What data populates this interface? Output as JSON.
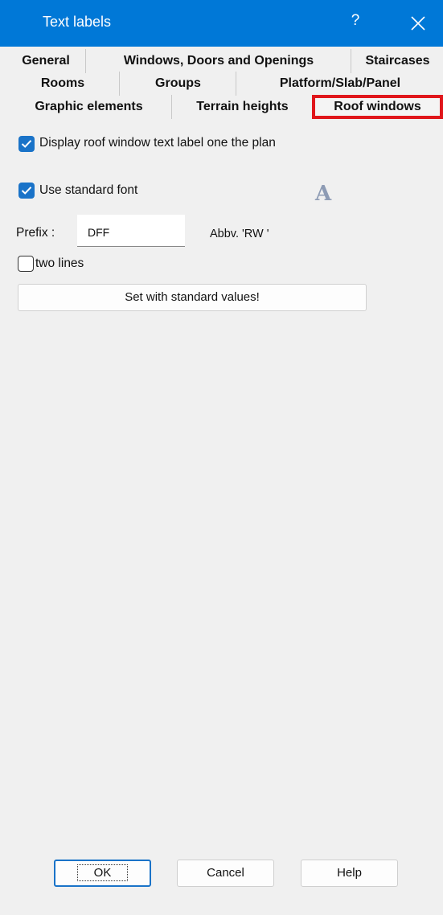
{
  "window": {
    "title": "Text labels",
    "help_glyph": "?",
    "close_icon": "close-icon",
    "title_bar_color": "#0078d7"
  },
  "tabs": {
    "row1": [
      "General",
      "Windows, Doors and Openings",
      "Staircases"
    ],
    "row2": [
      "Rooms",
      "Groups",
      "Platform/Slab/Panel"
    ],
    "row3": [
      "Graphic elements",
      "Terrain heights",
      "Roof windows"
    ],
    "active": "Roof windows",
    "active_highlight_color": "#e0161b"
  },
  "form": {
    "display_label_checkbox": {
      "label": "Display roof window text label one the plan",
      "checked": true
    },
    "standard_font_checkbox": {
      "label": "Use standard font",
      "checked": true
    },
    "font_icon_glyph": "A",
    "prefix": {
      "label": "Prefix :",
      "value": "DFF",
      "abbreviation": "Abbv. 'RW '"
    },
    "two_lines_checkbox": {
      "label": "two lines",
      "checked": false
    },
    "standard_values_button": "Set with standard values!"
  },
  "footer": {
    "ok": "OK",
    "cancel": "Cancel",
    "help": "Help"
  }
}
